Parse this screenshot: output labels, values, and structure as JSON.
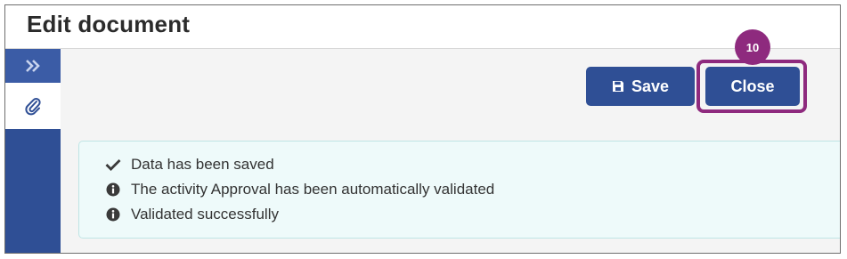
{
  "header": {
    "title": "Edit document"
  },
  "sidebar": {
    "expand_icon": "double-chevron-right-icon",
    "attach_icon": "paperclip-icon"
  },
  "toolbar": {
    "save_label": "Save",
    "save_icon": "floppy-disk-icon",
    "close_label": "Close",
    "step_badge": "10"
  },
  "alert": {
    "messages": [
      {
        "icon": "checkmark-icon",
        "text": "Data has been saved"
      },
      {
        "icon": "info-circle-icon",
        "text": "The activity Approval has been automatically validated"
      },
      {
        "icon": "info-circle-icon",
        "text": "Validated successfully"
      }
    ]
  },
  "colors": {
    "primary": "#2f4f95",
    "highlight": "#8e2a7e",
    "alert_bg": "#eefafa"
  }
}
